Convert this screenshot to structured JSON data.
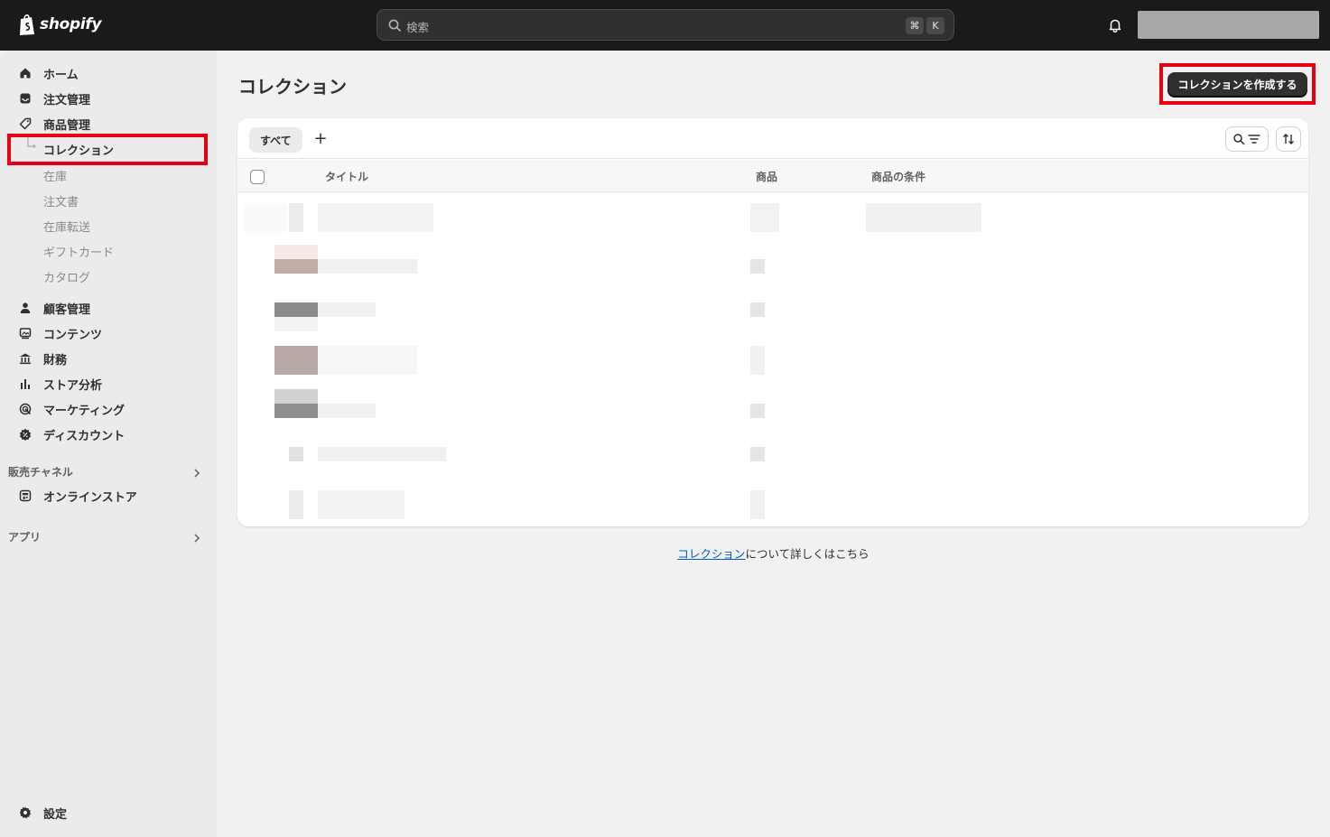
{
  "topbar": {
    "logo_text": "shopify",
    "search_placeholder": "検索",
    "shortcut_cmd": "⌘",
    "shortcut_key": "K"
  },
  "sidebar": {
    "items": [
      {
        "label": "ホーム",
        "icon": "home-icon"
      },
      {
        "label": "注文管理",
        "icon": "inbox-icon"
      },
      {
        "label": "商品管理",
        "icon": "tag-icon"
      }
    ],
    "product_sub_items": [
      {
        "label": "コレクション",
        "active": true
      },
      {
        "label": "在庫",
        "active": false
      },
      {
        "label": "注文書",
        "active": false
      },
      {
        "label": "在庫転送",
        "active": false
      },
      {
        "label": "ギフトカード",
        "active": false
      },
      {
        "label": "カタログ",
        "active": false
      }
    ],
    "items2": [
      {
        "label": "顧客管理",
        "icon": "person-icon"
      },
      {
        "label": "コンテンツ",
        "icon": "content-icon"
      },
      {
        "label": "財務",
        "icon": "bank-icon"
      },
      {
        "label": "ストア分析",
        "icon": "bar-chart-icon"
      },
      {
        "label": "マーケティング",
        "icon": "target-icon"
      },
      {
        "label": "ディスカウント",
        "icon": "discount-icon"
      }
    ],
    "sales_channels_label": "販売チャネル",
    "online_store_label": "オンラインストア",
    "apps_label": "アプリ",
    "settings_label": "設定"
  },
  "main": {
    "title": "コレクション",
    "create_button": "コレクションを作成する",
    "tab_all": "すべて",
    "tab_add": "+",
    "columns": [
      "タイトル",
      "商品",
      "商品の条件"
    ],
    "footer_link_text": "コレクション",
    "footer_rest_text": "について詳しくはこちら"
  },
  "colors": {
    "highlight": "#e60012",
    "topbar": "#1a1a1a",
    "link": "#005bd3"
  }
}
